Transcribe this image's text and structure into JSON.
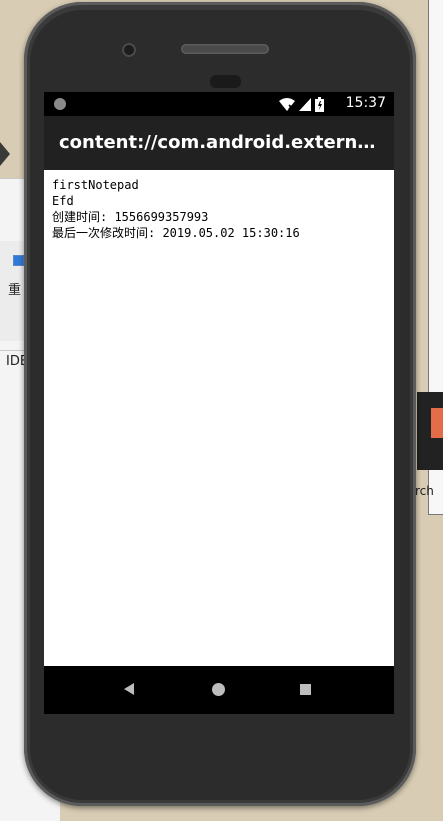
{
  "background": {
    "left_window": {
      "label_1": "重",
      "label_2": "IDE"
    },
    "right_window": {
      "label": "rch"
    }
  },
  "status_bar": {
    "time": "15:37",
    "icons": [
      "notification-dot-icon",
      "wifi-icon",
      "signal-icon",
      "battery-icon"
    ]
  },
  "app_bar": {
    "title": "content://com.android.externalsto..."
  },
  "note": {
    "title": "firstNotepad",
    "body": "Efd",
    "created": "创建时间: 1556699357993",
    "modified": "最后一次修改时间: 2019.05.02 15:30:16"
  },
  "nav_bar": {
    "buttons": [
      "back",
      "home",
      "recents"
    ]
  },
  "colors": {
    "app_bar": "#212121",
    "status_bar": "#000000",
    "screen_bg": "#ffffff",
    "phone_body": "#3a3a3a"
  }
}
